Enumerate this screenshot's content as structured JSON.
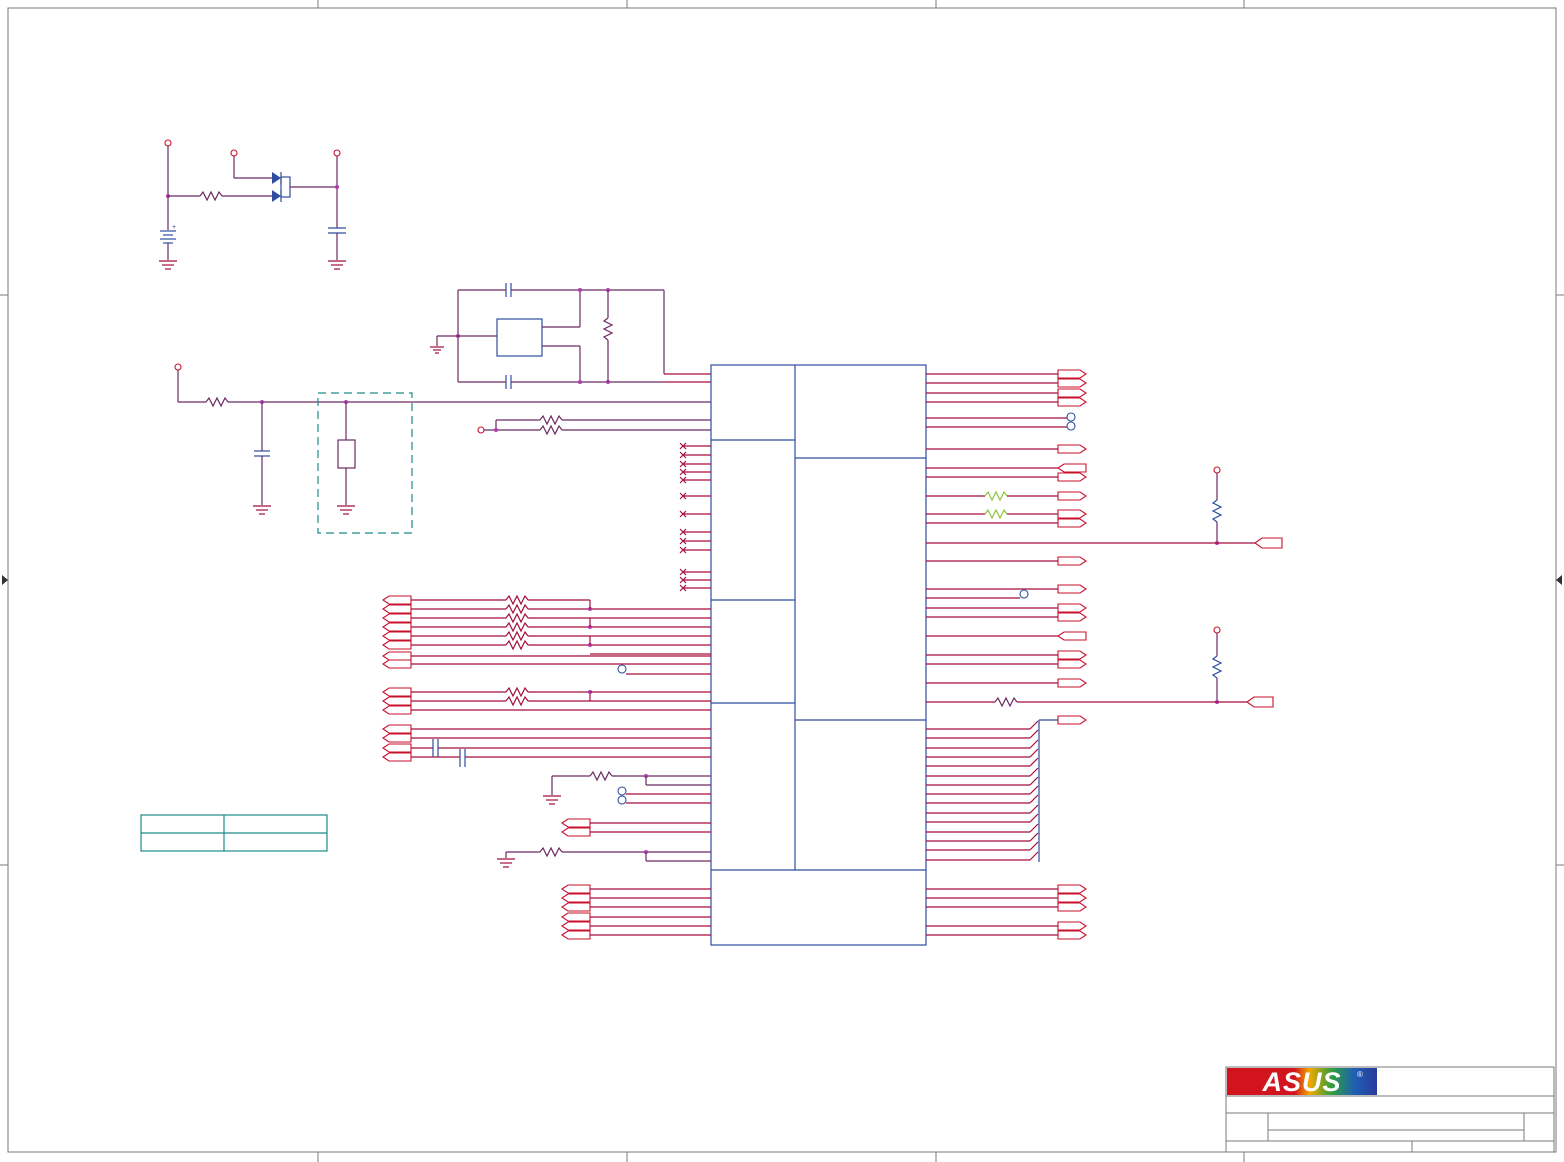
{
  "schematic": {
    "title_block": {
      "logo_text": "ASUS",
      "registered_mark": "®"
    },
    "colors": {
      "net_wire": "#a50d3a",
      "component": "#2f4da0",
      "frame": "#7a7a7a",
      "keepout_box": "#1f8a8a",
      "port_outline": "#c8102e",
      "logo_red": "#d2141e"
    },
    "icons": [
      "battery-icon",
      "diode-icon",
      "ground-icon",
      "resistor-icon",
      "capacitor-icon",
      "crystal-icon",
      "connector-port-icon",
      "test-point-icon"
    ]
  }
}
